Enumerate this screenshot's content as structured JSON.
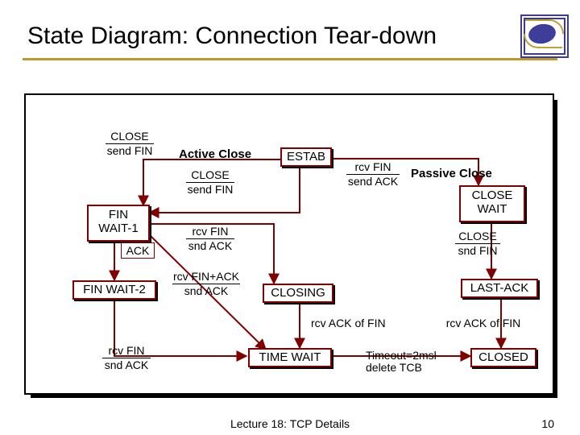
{
  "title": "State Diagram: Connection Tear-down",
  "footer": "Lecture 18: TCP Details",
  "pageNumber": "10",
  "passiveLabel": "Passive Close",
  "activeLabel": "Active Close",
  "states": {
    "estab": "ESTAB",
    "finWait1": "FIN\nWAIT-1",
    "finWait2": "FIN WAIT-2",
    "closing": "CLOSING",
    "timeWait": "TIME WAIT",
    "closeWait": "CLOSE\nWAIT",
    "lastAck": "LAST-ACK",
    "closed": "CLOSED",
    "ack": "ACK"
  },
  "transitions": {
    "closeSendFin1": {
      "event": "CLOSE",
      "action": "send FIN"
    },
    "closeSendFin2": {
      "event": "CLOSE",
      "action": "send FIN"
    },
    "rcvFinSendAck": {
      "event": "rcv FIN",
      "action": "send ACK"
    },
    "rcvFinSndAck1": {
      "event": "rcv FIN",
      "action": "snd ACK"
    },
    "rcvFinAckSndAck": {
      "event": "rcv FIN+ACK",
      "action": "snd ACK"
    },
    "closeSndFin": {
      "event": "CLOSE",
      "action": "snd FIN"
    },
    "rcvAckOfFin1": "rcv ACK of FIN",
    "rcvAckOfFin2": "rcv ACK of FIN",
    "rcvFinSndAck2": {
      "event": "rcv FIN",
      "action": "snd ACK"
    },
    "timeoutDelete": {
      "event": "Timeout=2msl",
      "action": "delete TCB"
    }
  },
  "chart_data": {
    "type": "state_diagram",
    "title": "TCP Connection Tear-down",
    "nodes": [
      {
        "id": "ESTAB",
        "label": "ESTAB"
      },
      {
        "id": "FIN_WAIT_1",
        "label": "FIN WAIT-1"
      },
      {
        "id": "FIN_WAIT_2",
        "label": "FIN WAIT-2"
      },
      {
        "id": "CLOSING",
        "label": "CLOSING"
      },
      {
        "id": "TIME_WAIT",
        "label": "TIME WAIT"
      },
      {
        "id": "CLOSE_WAIT",
        "label": "CLOSE WAIT"
      },
      {
        "id": "LAST_ACK",
        "label": "LAST-ACK"
      },
      {
        "id": "CLOSED",
        "label": "CLOSED"
      }
    ],
    "edges": [
      {
        "from": "ESTAB",
        "to": "FIN_WAIT_1",
        "event": "CLOSE",
        "action": "send FIN",
        "side": "Active Close"
      },
      {
        "from": "ESTAB",
        "to": "CLOSE_WAIT",
        "event": "rcv FIN",
        "action": "send ACK",
        "side": "Passive Close"
      },
      {
        "from": "FIN_WAIT_1",
        "to": "FIN_WAIT_2",
        "event": "ACK",
        "action": ""
      },
      {
        "from": "FIN_WAIT_1",
        "to": "CLOSING",
        "event": "rcv FIN",
        "action": "snd ACK"
      },
      {
        "from": "FIN_WAIT_1",
        "to": "TIME_WAIT",
        "event": "rcv FIN+ACK",
        "action": "snd ACK"
      },
      {
        "from": "FIN_WAIT_2",
        "to": "TIME_WAIT",
        "event": "rcv FIN",
        "action": "snd ACK"
      },
      {
        "from": "CLOSING",
        "to": "TIME_WAIT",
        "event": "rcv ACK of FIN",
        "action": ""
      },
      {
        "from": "CLOSE_WAIT",
        "to": "LAST_ACK",
        "event": "CLOSE",
        "action": "snd FIN"
      },
      {
        "from": "LAST_ACK",
        "to": "CLOSED",
        "event": "rcv ACK of FIN",
        "action": ""
      },
      {
        "from": "TIME_WAIT",
        "to": "CLOSED",
        "event": "Timeout=2msl",
        "action": "delete TCB"
      }
    ]
  }
}
